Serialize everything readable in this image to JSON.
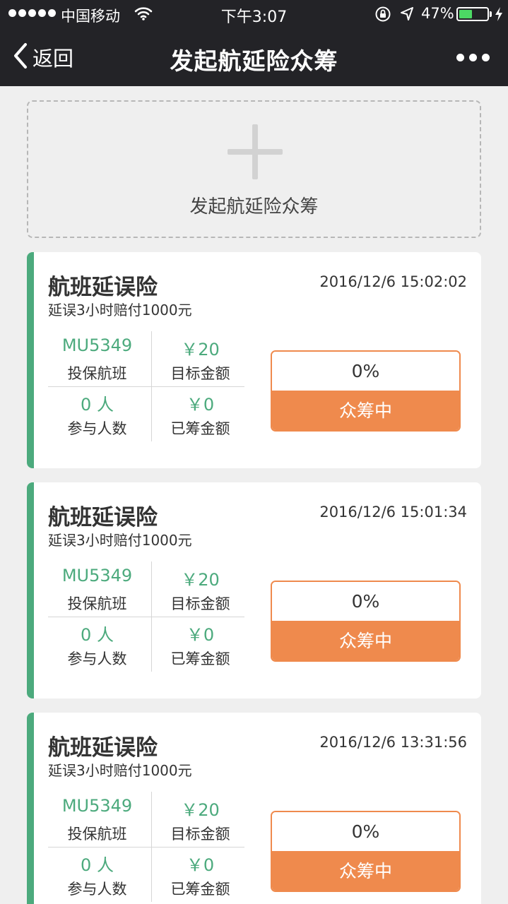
{
  "status_bar": {
    "carrier": "中国移动",
    "time": "下午3:07",
    "battery_percent_text": "47%",
    "battery_level": 0.47,
    "signal_bars": 5
  },
  "nav": {
    "back_label": "返回",
    "title": "发起航延险众筹"
  },
  "add_box": {
    "label": "发起航延险众筹"
  },
  "colors": {
    "nav_bg": "#232327",
    "page_bg": "#efefef",
    "accent_green": "#4caa7d",
    "accent_orange": "#ef8a4d",
    "battery_green": "#4cd964"
  },
  "cards": [
    {
      "title": "航班延误险",
      "time": "2016/12/6 15:02:02",
      "desc": "延误3小时赔付1000元",
      "flight": "MU5349",
      "flight_label": "投保航班",
      "target": "￥20",
      "target_label": "目标金额",
      "participants": "0 人",
      "participants_label": "参与人数",
      "raised": "￥0",
      "raised_label": "已筹金额",
      "progress": "0%",
      "status": "众筹中"
    },
    {
      "title": "航班延误险",
      "time": "2016/12/6 15:01:34",
      "desc": "延误3小时赔付1000元",
      "flight": "MU5349",
      "flight_label": "投保航班",
      "target": "￥20",
      "target_label": "目标金额",
      "participants": "0 人",
      "participants_label": "参与人数",
      "raised": "￥0",
      "raised_label": "已筹金额",
      "progress": "0%",
      "status": "众筹中"
    },
    {
      "title": "航班延误险",
      "time": "2016/12/6 13:31:56",
      "desc": "延误3小时赔付1000元",
      "flight": "MU5349",
      "flight_label": "投保航班",
      "target": "￥20",
      "target_label": "目标金额",
      "participants": "0 人",
      "participants_label": "参与人数",
      "raised": "￥0",
      "raised_label": "已筹金额",
      "progress": "0%",
      "status": "众筹中"
    }
  ]
}
